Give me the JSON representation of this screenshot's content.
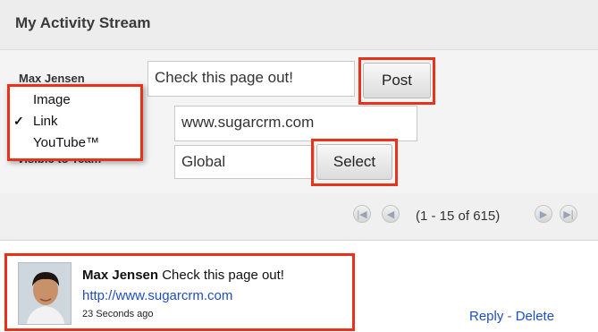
{
  "header": {
    "title": "My Activity Stream"
  },
  "form": {
    "user_label": "Max Jensen",
    "visible_label": "Visible to Team",
    "post_input_value": "Check this page out!",
    "url_input_value": "www.sugarcrm.com",
    "team_input_value": "Global",
    "post_button": "Post",
    "select_button": "Select"
  },
  "menu": {
    "items": [
      {
        "label": "Image",
        "checked": false
      },
      {
        "label": "Link",
        "checked": true,
        "check_mark": "✓"
      },
      {
        "label": "YouTube™",
        "checked": false
      }
    ]
  },
  "pager": {
    "first_icon": "first-page-icon",
    "prev_icon": "previous-page-icon",
    "range_text": "(1 - 15 of 615)",
    "next_icon": "next-page-icon",
    "last_icon": "last-page-icon"
  },
  "post": {
    "author": "Max Jensen",
    "message": "Check this page out!",
    "link": "http://www.sugarcrm.com",
    "time": "23 Seconds ago",
    "reply": "Reply",
    "separator": "-",
    "delete": "Delete"
  },
  "colors": {
    "highlight": "#e8331a",
    "link": "#1f4fbf",
    "header_bg": "#ededed"
  }
}
